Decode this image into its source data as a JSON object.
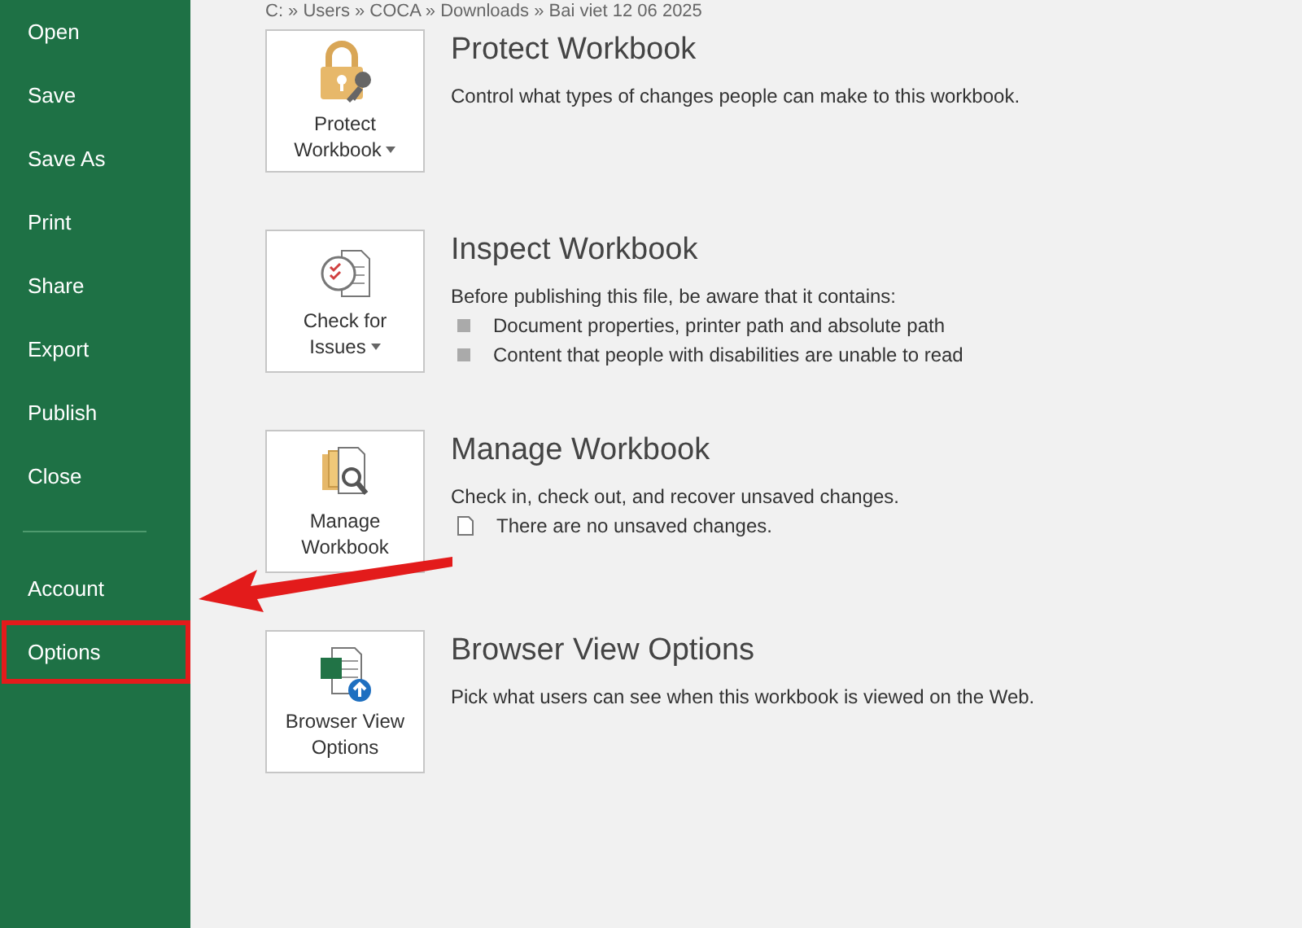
{
  "sidebar": {
    "items": [
      {
        "label": "Open",
        "callout": false
      },
      {
        "label": "Save",
        "callout": false
      },
      {
        "label": "Save As",
        "callout": false
      },
      {
        "label": "Print",
        "callout": false
      },
      {
        "label": "Share",
        "callout": false
      },
      {
        "label": "Export",
        "callout": false
      },
      {
        "label": "Publish",
        "callout": false
      },
      {
        "label": "Close",
        "callout": false
      },
      {
        "label": "Account",
        "callout": false
      },
      {
        "label": "Options",
        "callout": true
      }
    ]
  },
  "path": "C: » Users » COCA » Downloads » Bai viet 12 06 2025",
  "sections": [
    {
      "kind": "protect",
      "button": "Protect Workbook",
      "dropdown": true,
      "title": "Protect Workbook",
      "description": "Control what types of changes people can make to this workbook."
    },
    {
      "kind": "inspect",
      "button": "Check for Issues",
      "dropdown": true,
      "title": "Inspect Workbook",
      "description": "Before publishing this file, be aware that it contains:",
      "bullets": [
        "Document properties, printer path and absolute path",
        "Content that people with disabilities are unable to read"
      ]
    },
    {
      "kind": "manage",
      "button": "Manage Workbook",
      "dropdown": false,
      "title": "Manage Workbook",
      "description": "Check in, check out, and recover unsaved changes.",
      "note": "There are no unsaved changes."
    },
    {
      "kind": "browser",
      "button": "Browser View Options",
      "dropdown": false,
      "title": "Browser View Options",
      "description": "Pick what users can see when this workbook is viewed on the Web."
    }
  ]
}
